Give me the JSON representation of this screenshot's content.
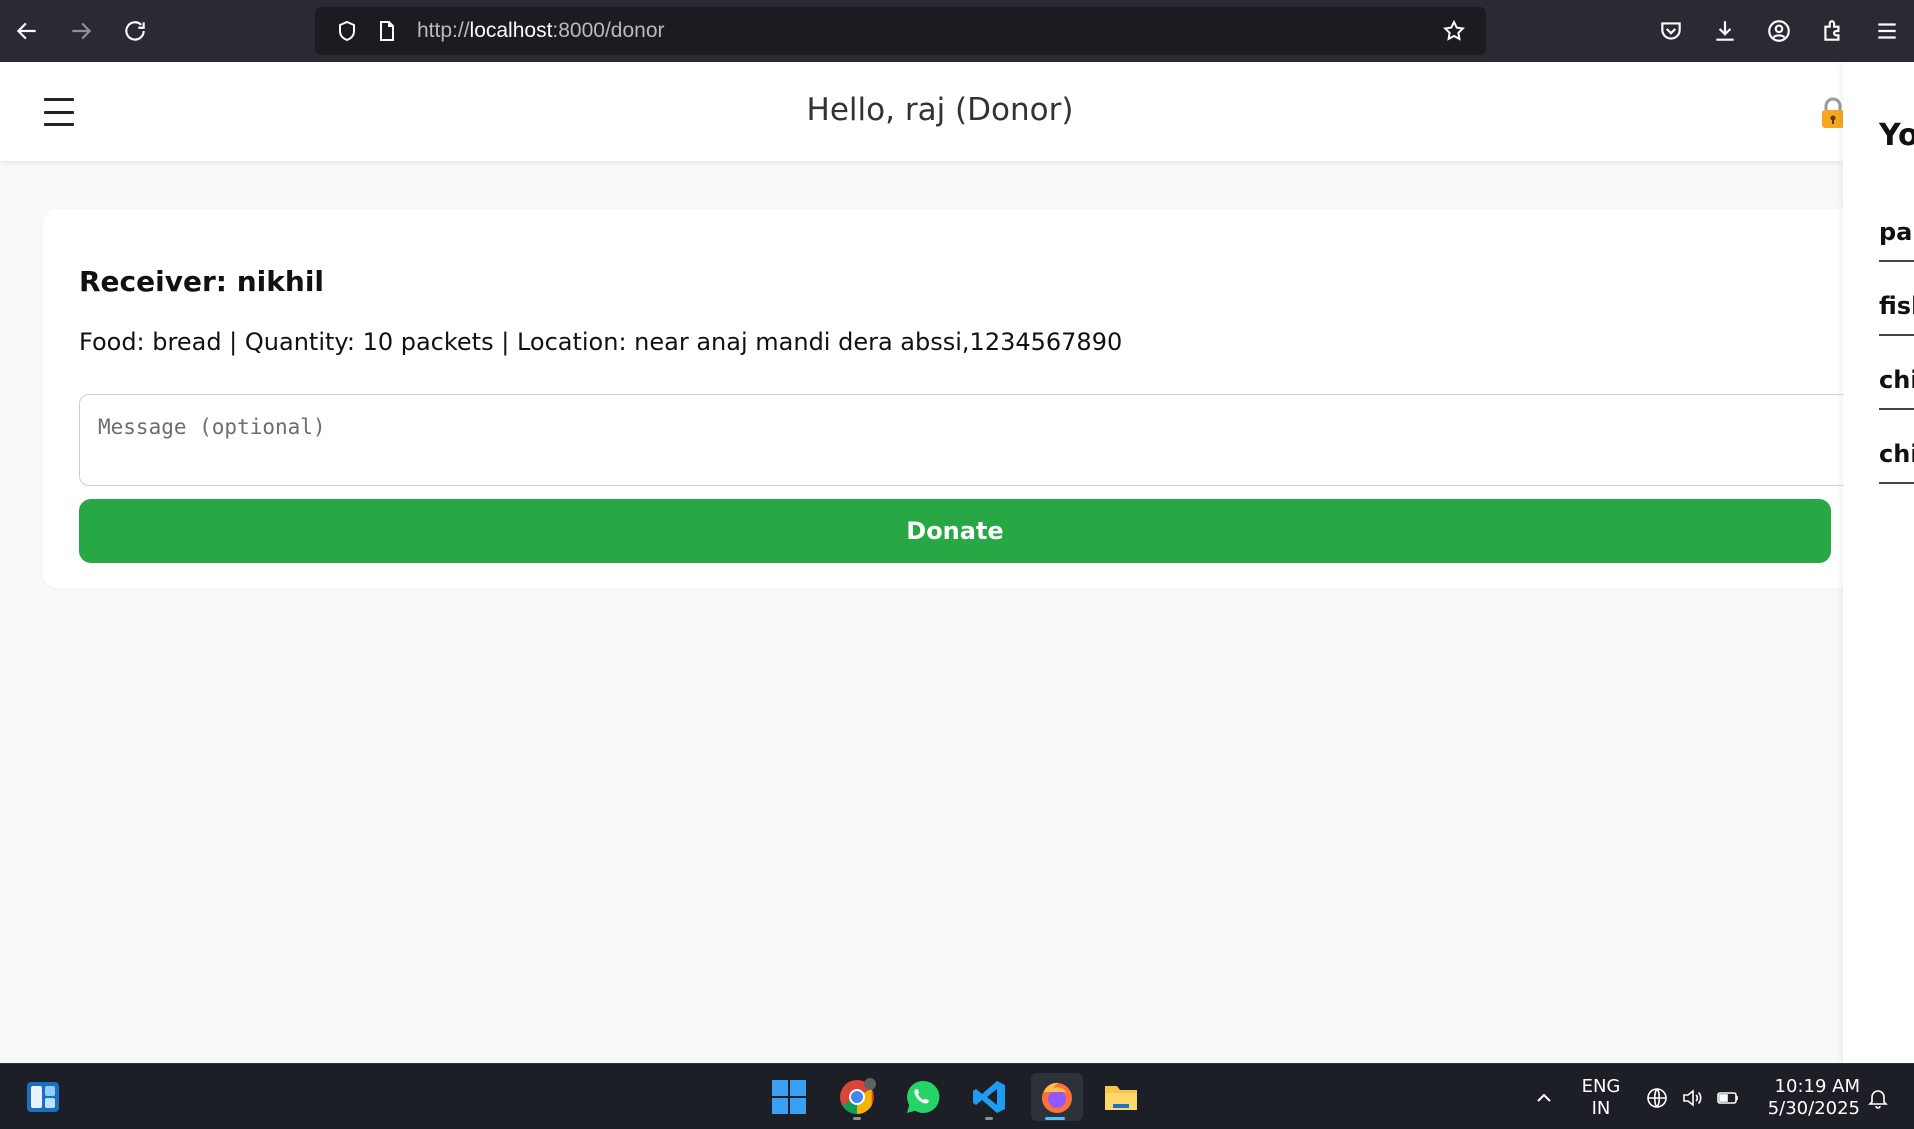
{
  "browser": {
    "url_prefix": "http://",
    "url_host": "localhost",
    "url_rest": ":8000/donor"
  },
  "header": {
    "greeting": "Hello, raj (Donor)"
  },
  "side_panel": {
    "title": "You",
    "items": [
      "par",
      "fish",
      "chi",
      "chi"
    ]
  },
  "card": {
    "receiver": "Receiver: nikhil",
    "details": "Food: bread | Quantity: 10 packets | Location: near anaj mandi dera abssi,1234567890",
    "message_placeholder": "Message (optional)",
    "donate_label": "Donate"
  },
  "taskbar": {
    "lang_top": "ENG",
    "lang_bottom": "IN",
    "time": "10:19 AM",
    "date": "5/30/2025"
  },
  "colors": {
    "donate_green": "#28a745",
    "chrome_dark": "#2b2a33",
    "taskbar": "#1c1f26"
  }
}
